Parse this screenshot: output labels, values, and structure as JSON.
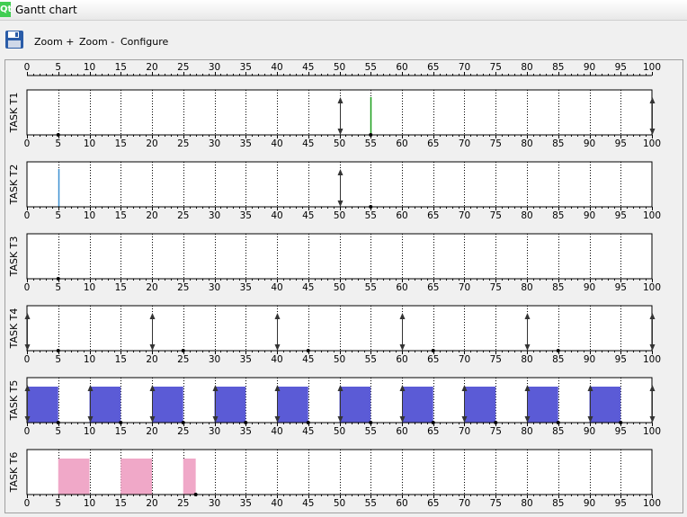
{
  "window": {
    "title": "Gantt chart",
    "logo_text": "Qt"
  },
  "toolbar": {
    "save_icon": "floppy-disk-icon",
    "zoom_in_label": "Zoom +",
    "zoom_out_label": "Zoom -",
    "configure_label": "Configure"
  },
  "colors": {
    "t5_bar": "#5b5bd6",
    "t6_bar": "#f0a8c8",
    "t1_marker": "#1a9e1a",
    "t2_marker": "#3d8fd0"
  },
  "chart_data": {
    "type": "gantt",
    "x_ticks": [
      0,
      5,
      10,
      15,
      20,
      25,
      30,
      35,
      40,
      45,
      50,
      55,
      60,
      65,
      70,
      75,
      80,
      85,
      90,
      95,
      100
    ],
    "xlim": [
      0,
      100
    ],
    "grid": true,
    "rows": [
      {
        "label": "TASK T1",
        "arrivals": [
          50,
          100
        ],
        "deadlines": [
          5,
          55
        ],
        "bars": [],
        "markers": [
          {
            "x": 55,
            "color": "green"
          }
        ]
      },
      {
        "label": "TASK T2",
        "arrivals": [
          50
        ],
        "deadlines": [
          55
        ],
        "bars": [],
        "markers": [
          {
            "x": 5,
            "color": "blue"
          }
        ]
      },
      {
        "label": "TASK T3",
        "arrivals": [],
        "deadlines": [
          5
        ],
        "bars": [],
        "markers": []
      },
      {
        "label": "TASK T4",
        "arrivals": [
          0,
          20,
          40,
          60,
          80,
          100
        ],
        "deadlines": [
          5,
          25,
          45,
          65,
          85
        ],
        "bars": [],
        "markers": []
      },
      {
        "label": "TASK T5",
        "arrivals": [
          0,
          10,
          20,
          30,
          40,
          50,
          60,
          70,
          80,
          90,
          100
        ],
        "deadlines": [
          5,
          15,
          25,
          35,
          45,
          55,
          65,
          75,
          85,
          95
        ],
        "bars": [
          [
            0,
            5
          ],
          [
            10,
            15
          ],
          [
            20,
            25
          ],
          [
            30,
            35
          ],
          [
            40,
            45
          ],
          [
            50,
            55
          ],
          [
            60,
            65
          ],
          [
            70,
            75
          ],
          [
            80,
            85
          ],
          [
            90,
            95
          ]
        ],
        "markers": []
      },
      {
        "label": "TASK T6",
        "arrivals": [],
        "deadlines": [
          27
        ],
        "bars": [
          [
            5,
            10
          ],
          [
            15,
            20
          ],
          [
            25,
            27
          ]
        ],
        "markers": []
      }
    ]
  }
}
